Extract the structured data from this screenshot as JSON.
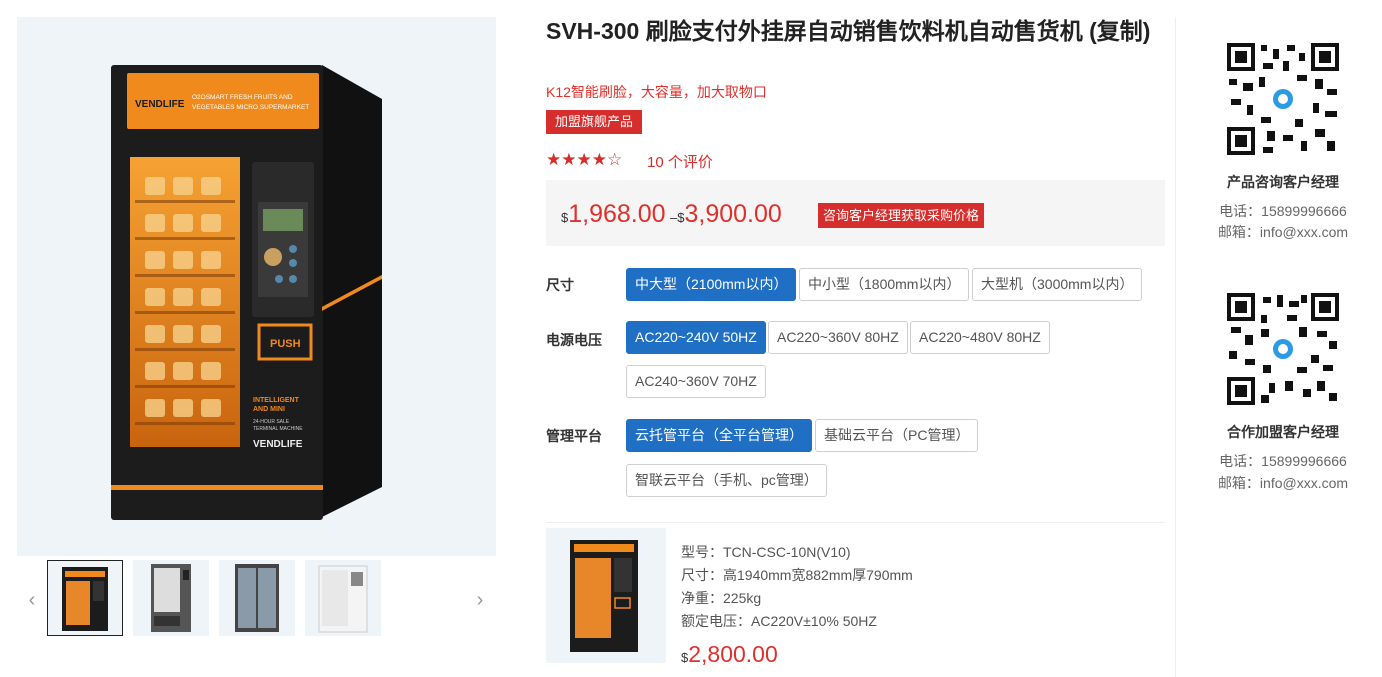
{
  "product": {
    "title": "SVH-300 刷脸支付外挂屏自动销售饮料机自动售货机 (复制)",
    "subtitle": "K12智能刷脸，大容量，加大取物口",
    "badge": "加盟旗舰产品",
    "rating": 4,
    "stars_text": "★★★★☆",
    "reviews": "10 个评价",
    "price_currency": "$",
    "price_low": "1,968.00",
    "price_sep": "–",
    "price_high": "3,900.00",
    "price_tag": "咨询客户经理获取采购价格"
  },
  "image_text": {
    "brand": "VENDLIFE",
    "header_line1": "O2OSMART FRESH FRUITS AND",
    "header_line2": "VEGETABLES MICRO SUPERMARKET",
    "push": "PUSH",
    "side_line1": "INTELLIGENT",
    "side_line2": "AND MINI",
    "side_line3": "24-HOUR SALE",
    "side_line4": "TERMINAL MACHINE",
    "side_brand": "VENDLIFE"
  },
  "options": [
    {
      "label": "尺寸",
      "values": [
        "中大型（2100mm以内）",
        "中小型（1800mm以内）",
        "大型机（3000mm以内）"
      ],
      "selected": 0
    },
    {
      "label": "电源电压",
      "values": [
        "AC220~240V 50HZ",
        "AC220~360V 80HZ",
        "AC220~480V 80HZ",
        "AC240~360V 70HZ"
      ],
      "selected": 0
    },
    {
      "label": "管理平台",
      "values": [
        "云托管平台（全平台管理）",
        "基础云平台（PC管理）",
        "智联云平台（手机、pc管理）"
      ],
      "selected": 0
    }
  ],
  "variant": {
    "model": "型号：TCN-CSC-10N(V10)",
    "size": "尺寸：高1940mm宽882mm厚790mm",
    "weight": "净重：225kg",
    "voltage": "额定电压：AC220V±10% 50HZ",
    "currency": "$",
    "price": "2,800.00"
  },
  "gallery": {
    "prev": "‹",
    "next": "›"
  },
  "managers": [
    {
      "title": "产品咨询客户经理",
      "phone": "电话：15899996666",
      "email": "邮箱：info@xxx.com"
    },
    {
      "title": "合作加盟客户经理",
      "phone": "电话：15899996666",
      "email": "邮箱：info@xxx.com"
    }
  ],
  "colors": {
    "accent": "#d62e2c",
    "selected": "#1f6fc5",
    "machine": "#1c1c1c",
    "glow": "#f08a1c"
  }
}
